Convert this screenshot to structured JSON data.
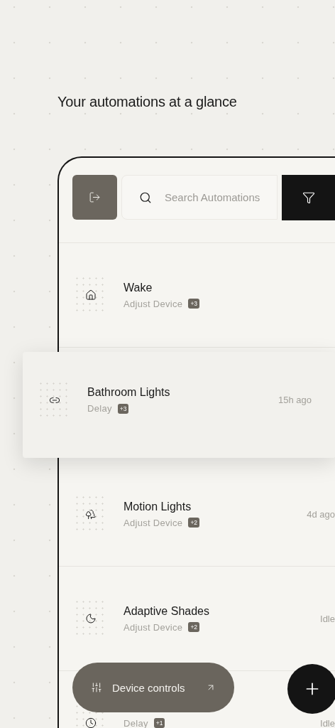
{
  "heading": "Your automations at a glance",
  "search": {
    "placeholder": "Search Automations"
  },
  "rows": [
    {
      "name": "Wake",
      "action": "Adjust Device",
      "badge": "+3",
      "raised": false
    },
    {
      "name": "Bathroom Lights",
      "action": "Delay",
      "badge": "+3",
      "time": "15h ago",
      "raised": true
    },
    {
      "name": "Motion Lights",
      "action": "Adjust Device",
      "badge": "+2",
      "time": "4d ago",
      "raised": false
    },
    {
      "name": "Adaptive Shades",
      "action": "Adjust Device",
      "badge": "+2",
      "time": "Idle",
      "raised": false
    },
    {
      "action": "Delay",
      "badge": "+1",
      "time": "Idle",
      "raised": false
    }
  ],
  "device_controls": {
    "label": "Device controls"
  }
}
